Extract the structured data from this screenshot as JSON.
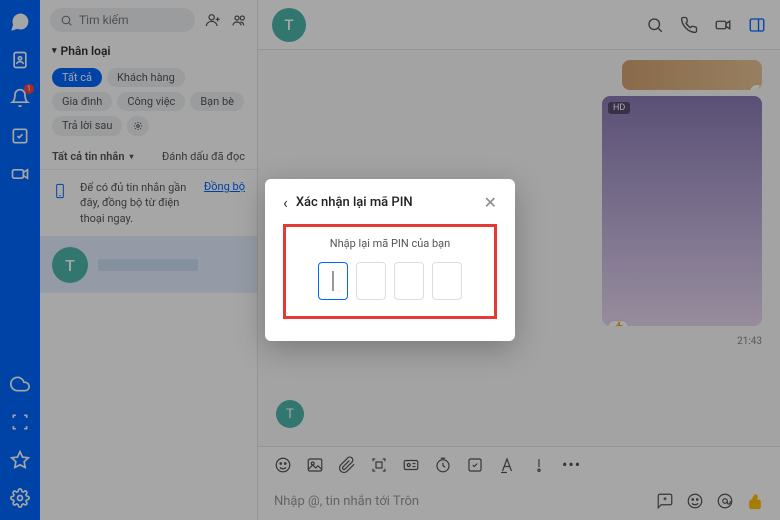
{
  "search": {
    "placeholder": "Tìm kiếm"
  },
  "sidebar": {
    "section_label": "Phân loại",
    "tags": [
      "Tất cả",
      "Khách hàng",
      "Gia đình",
      "Công việc",
      "Bạn bè",
      "Trả lời sau"
    ],
    "filter_label": "Tất cả tin nhắn",
    "mark_read": "Đánh dấu đã đọc",
    "sync_text": "Để có đủ tin nhắn gần đây, đồng bộ từ điện thoại ngay.",
    "sync_link": "Đồng bộ",
    "conv_avatar": "T"
  },
  "header": {
    "avatar": "T"
  },
  "messages": {
    "hd_badge": "HD",
    "time": "21:43",
    "reply_avatar": "T"
  },
  "composer": {
    "placeholder": "Nhập @, tin nhắn tới Trôn"
  },
  "dialog": {
    "title": "Xác nhận lại mã PIN",
    "subtitle": "Nhập lại mã PIN của bạn"
  },
  "rail_badge": "1"
}
